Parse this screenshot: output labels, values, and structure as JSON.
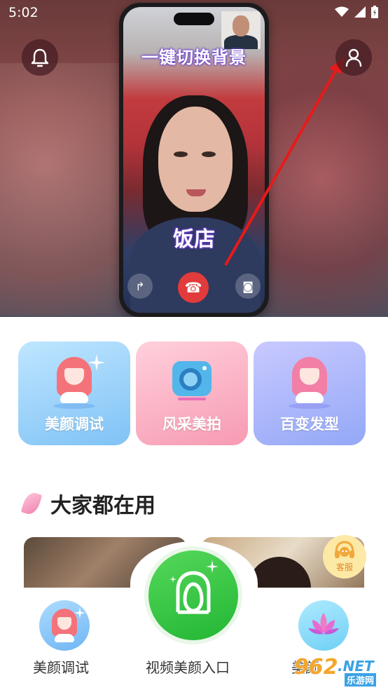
{
  "status_bar": {
    "time": "5:02"
  },
  "hero": {
    "phone_title": "一键切换背景",
    "phone_label": "饭店",
    "call_captions": [
      "",
      "",
      ""
    ]
  },
  "features": [
    {
      "label": "美颜调试",
      "hair": "#f4737a"
    },
    {
      "label": "风采美拍",
      "hair": "#52b6ea"
    },
    {
      "label": "百变发型",
      "hair": "#f27fa6"
    }
  ],
  "section": {
    "title": "大家都在用"
  },
  "service": {
    "label": "客服"
  },
  "bottom_nav": {
    "left_label": "美颜调试",
    "center_label": "视频美颜入口",
    "right_label": "美颜"
  },
  "watermark": {
    "text": "962",
    "sub": ".NET",
    "cn": "乐游网"
  },
  "colors": {
    "accent_green": "#23b634",
    "arrow_red": "#e81a1a"
  }
}
